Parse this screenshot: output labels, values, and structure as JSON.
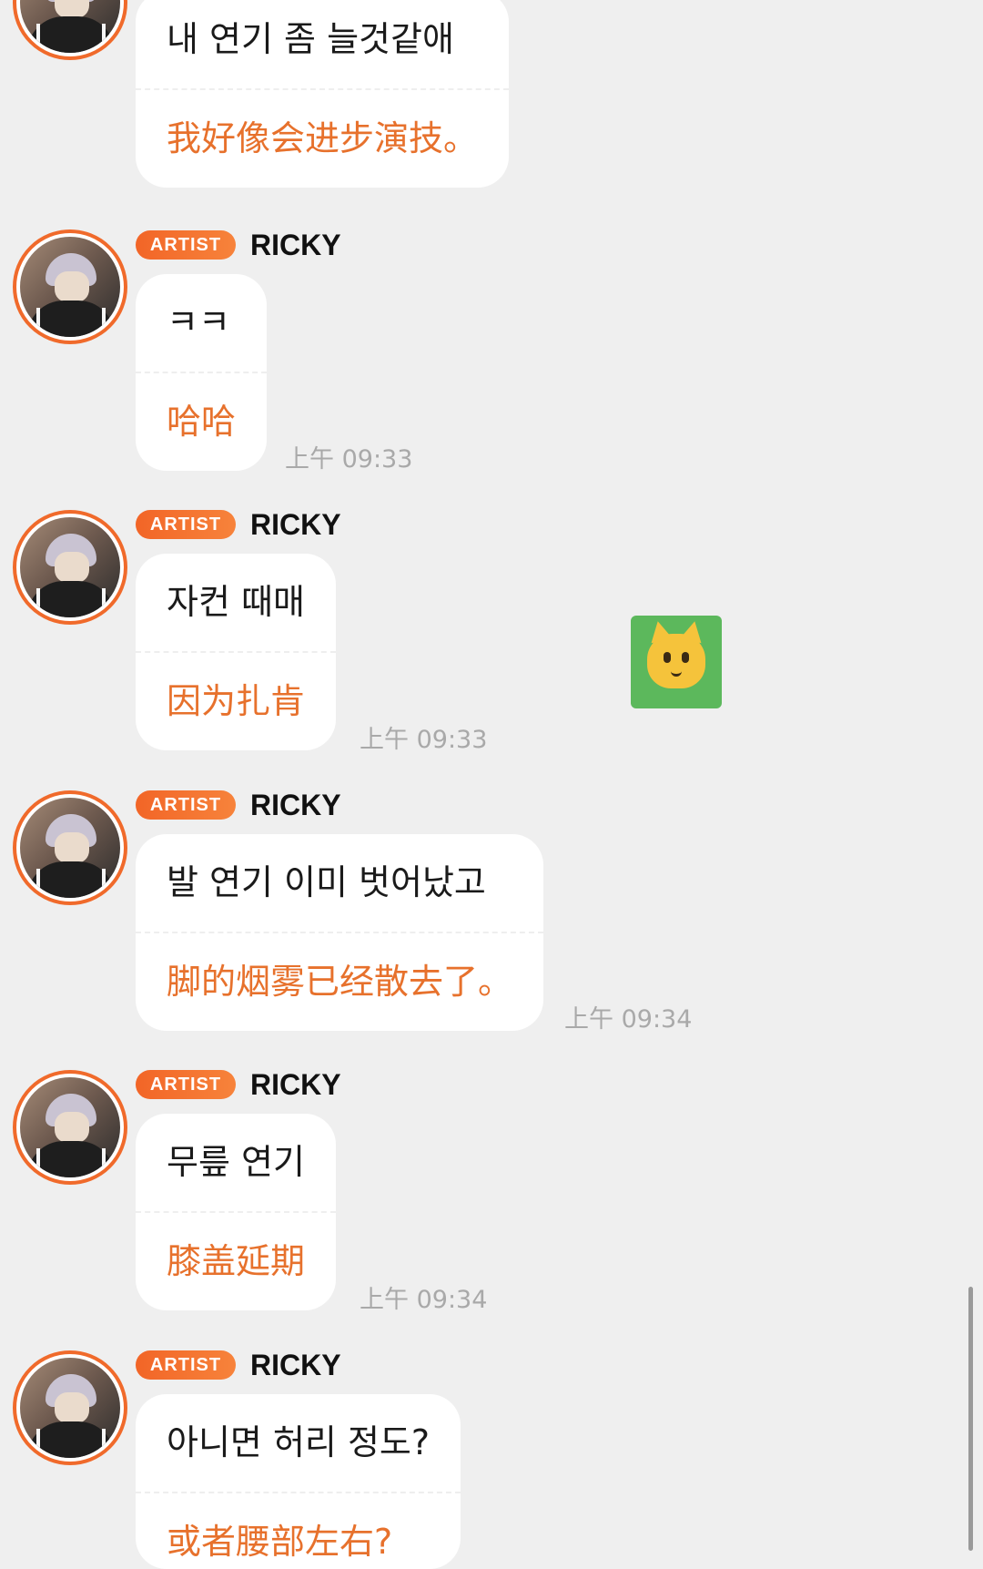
{
  "colors": {
    "background": "#efefef",
    "bubble": "#ffffff",
    "translation": "#e7712c",
    "badge": "#f26527",
    "sticker": "#5cb85c"
  },
  "messages": [
    {
      "show_header": false,
      "korean": "내 연기 좀 늘것같애",
      "chinese": "我好像会进步演技。",
      "time": ""
    },
    {
      "show_header": true,
      "badge": "ARTIST",
      "name": "RICKY",
      "korean": "ㅋㅋ",
      "chinese": "哈哈",
      "time": "上午 09:33"
    },
    {
      "show_header": true,
      "badge": "ARTIST",
      "name": "RICKY",
      "korean": "자컨 때매",
      "chinese": "因为扎肯",
      "time": "上午 09:33"
    },
    {
      "show_header": true,
      "badge": "ARTIST",
      "name": "RICKY",
      "korean": "발 연기 이미 벗어났고",
      "chinese": "脚的烟雾已经散去了。",
      "time": "上午 09:34"
    },
    {
      "show_header": true,
      "badge": "ARTIST",
      "name": "RICKY",
      "korean": "무릎 연기",
      "chinese": "膝盖延期",
      "time": "上午 09:34"
    },
    {
      "show_header": true,
      "badge": "ARTIST",
      "name": "RICKY",
      "korean": "아니면 허리 정도?",
      "chinese": "或者腰部左右?",
      "time": ""
    }
  ],
  "sticker": {
    "icon": "cat-face-icon"
  }
}
